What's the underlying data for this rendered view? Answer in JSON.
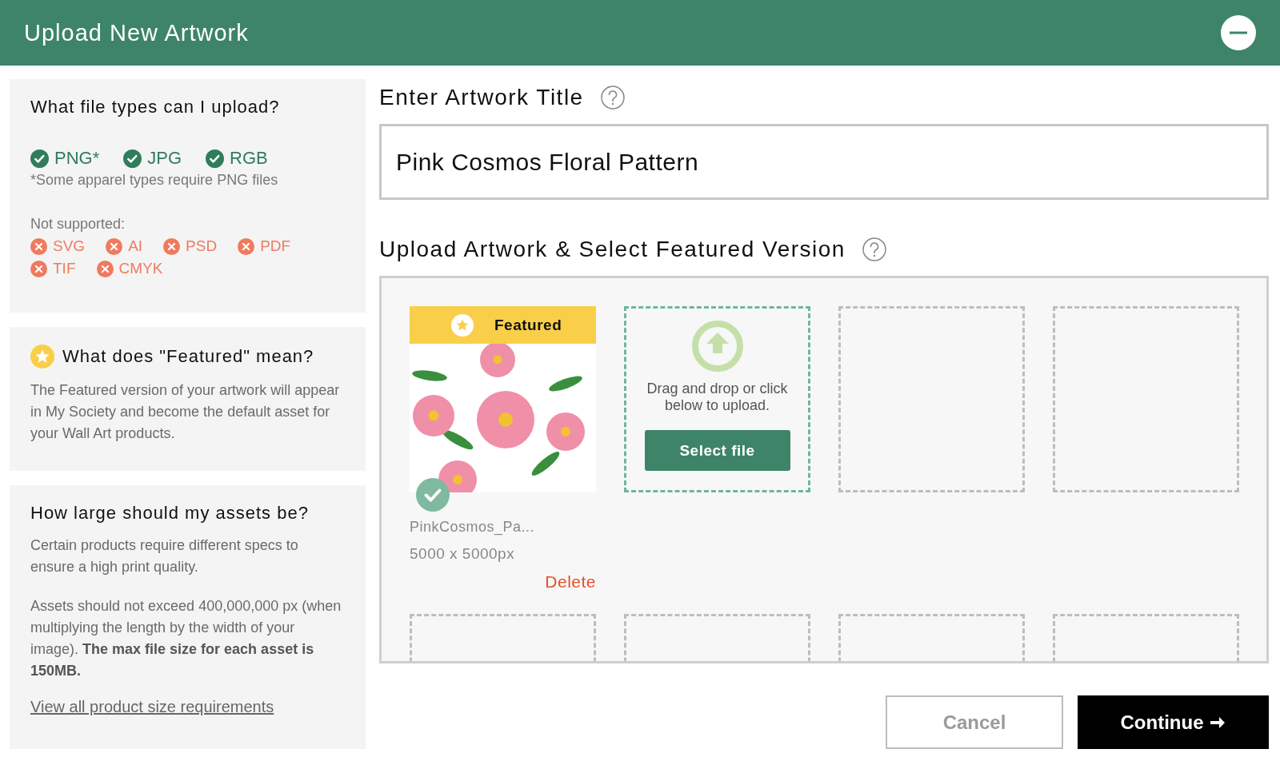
{
  "header": {
    "title": "Upload New Artwork"
  },
  "help_panels": [
    {
      "kind": "file_types",
      "title": "What file types can I upload?",
      "supported": [
        "PNG*",
        "JPG",
        "RGB"
      ],
      "note": "*Some apparel types require PNG files",
      "unsupported_label": "Not supported:",
      "unsupported": [
        "SVG",
        "AI",
        "PSD",
        "PDF",
        "TIF",
        "CMYK"
      ]
    },
    {
      "kind": "featured",
      "title": "What does \"Featured\" mean?",
      "body": "The Featured version of your artwork will appear in My Society and become the default asset for your Wall Art products."
    },
    {
      "kind": "sizes",
      "title": "How large should my assets be?",
      "paragraphs": [
        "Certain products require different specs to ensure a high print quality.",
        "Assets should not exceed 400,000,000 px (when multiplying the length by the width of your image). **The max file size for each asset is 150MB.**"
      ],
      "link": "View all product size requirements"
    }
  ],
  "title_field": {
    "label": "Enter Artwork Title",
    "value": "Pink Cosmos Floral Pattern"
  },
  "upload": {
    "label": "Upload Artwork & Select Featured Version",
    "slots": [
      {
        "kind": "artwork",
        "featured": true,
        "badge": "Featured",
        "selected": true,
        "filename": "PinkCosmos_Pa...",
        "dimensions": "5000 x 5000px",
        "action": "Delete"
      },
      {
        "kind": "dropzone",
        "prompt": "Drag and drop or click below to upload.",
        "button": "Select file"
      },
      {
        "kind": "empty"
      },
      {
        "kind": "empty"
      },
      {
        "kind": "empty"
      },
      {
        "kind": "empty"
      },
      {
        "kind": "empty"
      },
      {
        "kind": "empty"
      }
    ]
  },
  "buttons": [
    {
      "kind": "secondary",
      "label": "Cancel"
    },
    {
      "kind": "primary",
      "label": "Continue"
    }
  ]
}
